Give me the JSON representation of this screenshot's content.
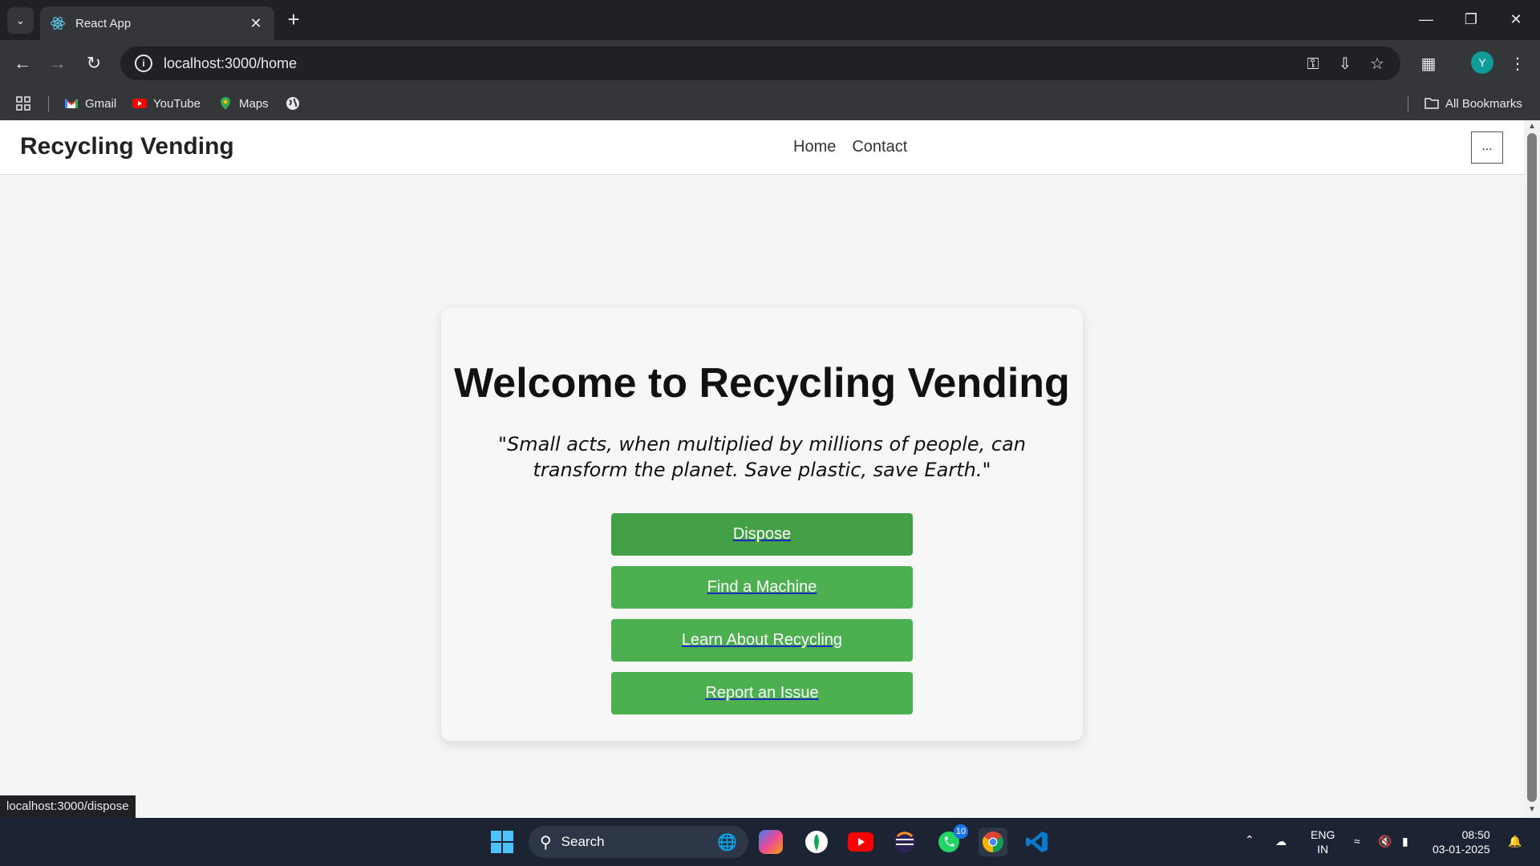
{
  "browser": {
    "tab_title": "React App",
    "url": "localhost:3000/home",
    "bookmarks": [
      {
        "label": "Gmail",
        "icon": "gmail-icon"
      },
      {
        "label": "YouTube",
        "icon": "youtube-icon"
      },
      {
        "label": "Maps",
        "icon": "maps-icon"
      }
    ],
    "all_bookmarks_label": "All Bookmarks",
    "profile_initial": "Y",
    "status_url": "localhost:3000/dispose"
  },
  "app": {
    "brand": "Recycling Vending",
    "nav": [
      "Home",
      "Contact"
    ],
    "menu_label": "..."
  },
  "hero": {
    "title": "Welcome to Recycling Vending",
    "quote": "\"Small acts, when multiplied by millions of people, can transform the planet. Save plastic, save Earth.\"",
    "buttons": [
      "Dispose",
      "Find a Machine",
      "Learn About Recycling",
      "Report an Issue"
    ]
  },
  "taskbar": {
    "search_label": "Search",
    "whatsapp_badge": "10",
    "language": "ENG",
    "region": "IN",
    "time": "08:50",
    "date": "03-01-2025"
  },
  "colors": {
    "button_green": "#4caf50",
    "chrome_dark": "#202124",
    "chrome_mid": "#35363a",
    "taskbar": "#1c2433"
  }
}
